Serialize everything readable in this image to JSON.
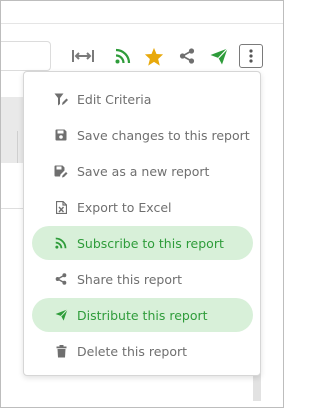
{
  "colors": {
    "accent_green": "#2e9c3a",
    "active_bg": "#d8f0d9",
    "star": "#e8a90c",
    "icon_grey": "#6f6f6f"
  },
  "toolbar": {
    "icons": [
      "expand-horizontal-icon",
      "rss-icon",
      "star-icon",
      "share-icon",
      "send-icon",
      "more-vertical-icon"
    ]
  },
  "menu": {
    "items": [
      {
        "label": "Edit Criteria",
        "icon": "filter-edit-icon",
        "active": false
      },
      {
        "label": "Save changes to this report",
        "icon": "save-icon",
        "active": false
      },
      {
        "label": "Save as a new report",
        "icon": "save-as-icon",
        "active": false
      },
      {
        "label": "Export to Excel",
        "icon": "excel-icon",
        "active": false
      },
      {
        "label": "Subscribe to this report",
        "icon": "rss-icon",
        "active": true
      },
      {
        "label": "Share this report",
        "icon": "share-icon",
        "active": false
      },
      {
        "label": "Distribute this report",
        "icon": "send-icon",
        "active": true
      },
      {
        "label": "Delete this report",
        "icon": "trash-icon",
        "active": false
      }
    ]
  }
}
